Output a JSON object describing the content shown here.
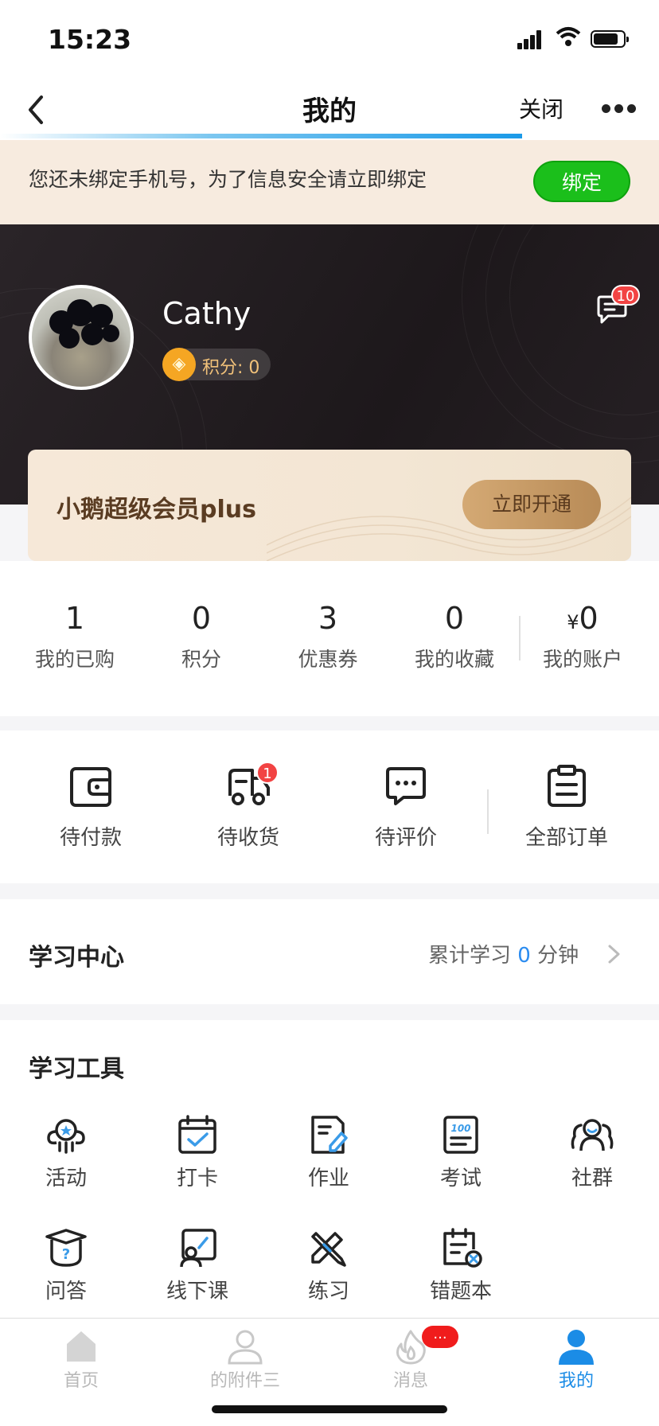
{
  "status_bar": {
    "time": "15:23"
  },
  "nav": {
    "title": "我的",
    "close_label": "关闭"
  },
  "bind_notice": {
    "text": "您还未绑定手机号，为了信息安全请立即绑定",
    "button": "绑定"
  },
  "profile": {
    "name": "Cathy",
    "points_label": "积分: 0",
    "message_badge": "10"
  },
  "vip": {
    "title": "小鹅超级会员plus",
    "button": "立即开通"
  },
  "stats": [
    {
      "value": "1",
      "label": "我的已购"
    },
    {
      "value": "0",
      "label": "积分"
    },
    {
      "value": "3",
      "label": "优惠券"
    },
    {
      "value": "0",
      "label": "我的收藏"
    },
    {
      "currency": "¥",
      "value": "0",
      "label": "我的账户"
    }
  ],
  "orders": [
    {
      "label": "待付款",
      "icon": "wallet-icon"
    },
    {
      "label": "待收货",
      "icon": "truck-icon",
      "badge": "1"
    },
    {
      "label": "待评价",
      "icon": "comment-icon"
    },
    {
      "label": "全部订单",
      "icon": "clipboard-icon"
    }
  ],
  "study_center": {
    "title": "学习中心",
    "prefix": "累计学习",
    "minutes": "0",
    "suffix": "分钟"
  },
  "tools": {
    "title": "学习工具",
    "items": [
      {
        "label": "活动",
        "icon": "activity-icon"
      },
      {
        "label": "打卡",
        "icon": "checkin-icon"
      },
      {
        "label": "作业",
        "icon": "homework-icon"
      },
      {
        "label": "考试",
        "icon": "exam-icon"
      },
      {
        "label": "社群",
        "icon": "community-icon"
      },
      {
        "label": "问答",
        "icon": "qa-icon"
      },
      {
        "label": "线下课",
        "icon": "offline-class-icon"
      },
      {
        "label": "练习",
        "icon": "practice-icon"
      },
      {
        "label": "错题本",
        "icon": "wrong-answers-icon"
      }
    ]
  },
  "tabbar": [
    {
      "label": "首页",
      "icon": "home-icon",
      "active": false
    },
    {
      "label": "的附件三",
      "icon": "person-outline-icon",
      "active": false
    },
    {
      "label": "消息",
      "icon": "flame-icon",
      "active": false,
      "badge": "..."
    },
    {
      "label": "我的",
      "icon": "person-icon",
      "active": true
    }
  ],
  "colors": {
    "accent": "#1b8ce6",
    "bind_green": "#1bbf1b",
    "badge_red": "#f24343",
    "vip_gold": "#c59a64",
    "hero_dark": "#221c1f"
  }
}
